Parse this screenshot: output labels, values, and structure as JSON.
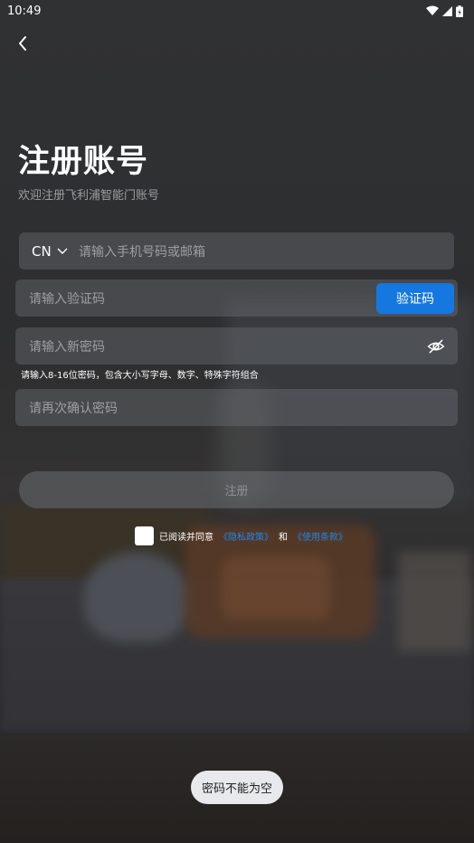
{
  "status_bar": {
    "time": "10:49"
  },
  "header": {
    "title": "注册账号",
    "subtitle": "欢迎注册飞利浦智能门账号"
  },
  "form": {
    "country_code": "CN",
    "phone_placeholder": "请输入手机号码或邮箱",
    "code_placeholder": "请输入验证码",
    "code_button": "验证码",
    "password_placeholder": "请输入新密码",
    "password_hint": "请输入8-16位密码，包含大小写字母、数字、特殊字符组合",
    "confirm_placeholder": "请再次确认密码",
    "submit_label": "注册"
  },
  "agreement": {
    "prefix": "已阅读并同意",
    "privacy_link": "《隐私政策》",
    "conjunction": "和",
    "terms_link": "《使用条款》",
    "checked": false
  },
  "toast": {
    "message": "密码不能为空"
  },
  "colors": {
    "accent": "#1478e0",
    "link": "#1f86e8"
  }
}
